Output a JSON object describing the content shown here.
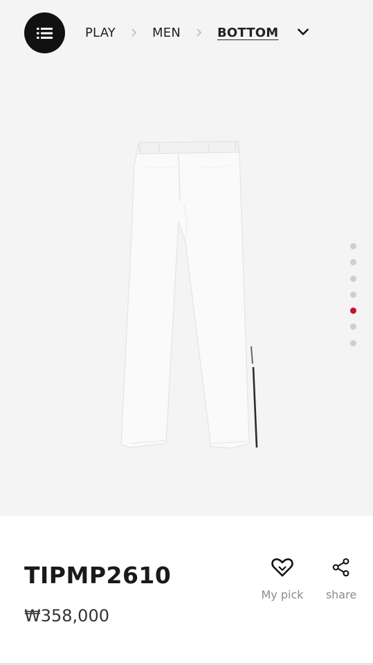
{
  "nav": {
    "breadcrumb": [
      {
        "label": "PLAY"
      },
      {
        "label": "MEN"
      },
      {
        "label": "BOTTOM"
      }
    ]
  },
  "gallery": {
    "total_slides": 7,
    "active_slide": 5
  },
  "product": {
    "name": "TIPMP2610",
    "price": "₩358,000"
  },
  "actions": {
    "my_pick_label": "My pick",
    "share_label": "share"
  },
  "colors": {
    "accent": "#c8102e",
    "hero_bg": "#f4f4f5"
  }
}
